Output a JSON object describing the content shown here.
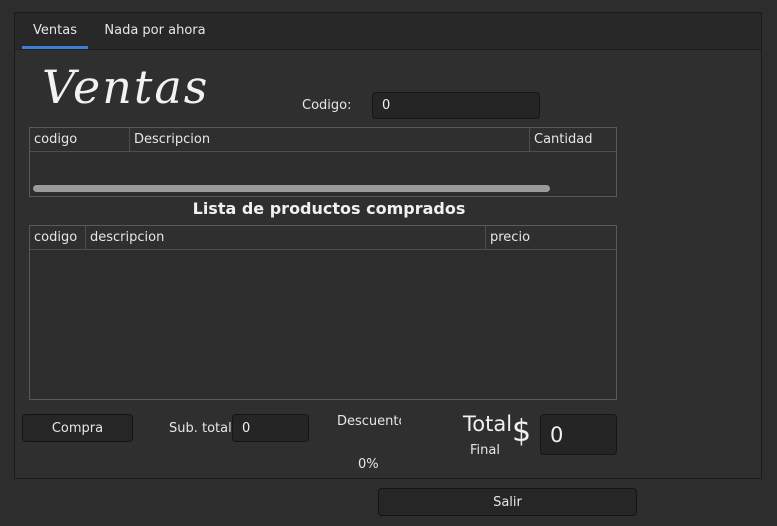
{
  "tabs": [
    {
      "label": "Ventas",
      "active": true
    },
    {
      "label": "Nada por ahora",
      "active": false
    }
  ],
  "header": {
    "title": "Ventas",
    "codigo_label": "Codigo:",
    "codigo_value": "0"
  },
  "search_table": {
    "columns": [
      "codigo",
      "Descripcion",
      "Cantidad"
    ]
  },
  "purchased": {
    "heading": "Lista de productos comprados",
    "columns": [
      "codigo",
      "descripcion",
      "precio"
    ]
  },
  "footer": {
    "compra_label": "Compra",
    "subtotal_label": "Sub. total $",
    "subtotal_value": "0",
    "descuento_label": "Descuento",
    "descuento_value": "0%",
    "total_label": "Total",
    "final_label": "Final",
    "currency_symbol": "$",
    "total_value": "0",
    "salir_label": "Salir"
  },
  "colors": {
    "accent": "#3d7dd8",
    "background": "#2d2d2d"
  }
}
